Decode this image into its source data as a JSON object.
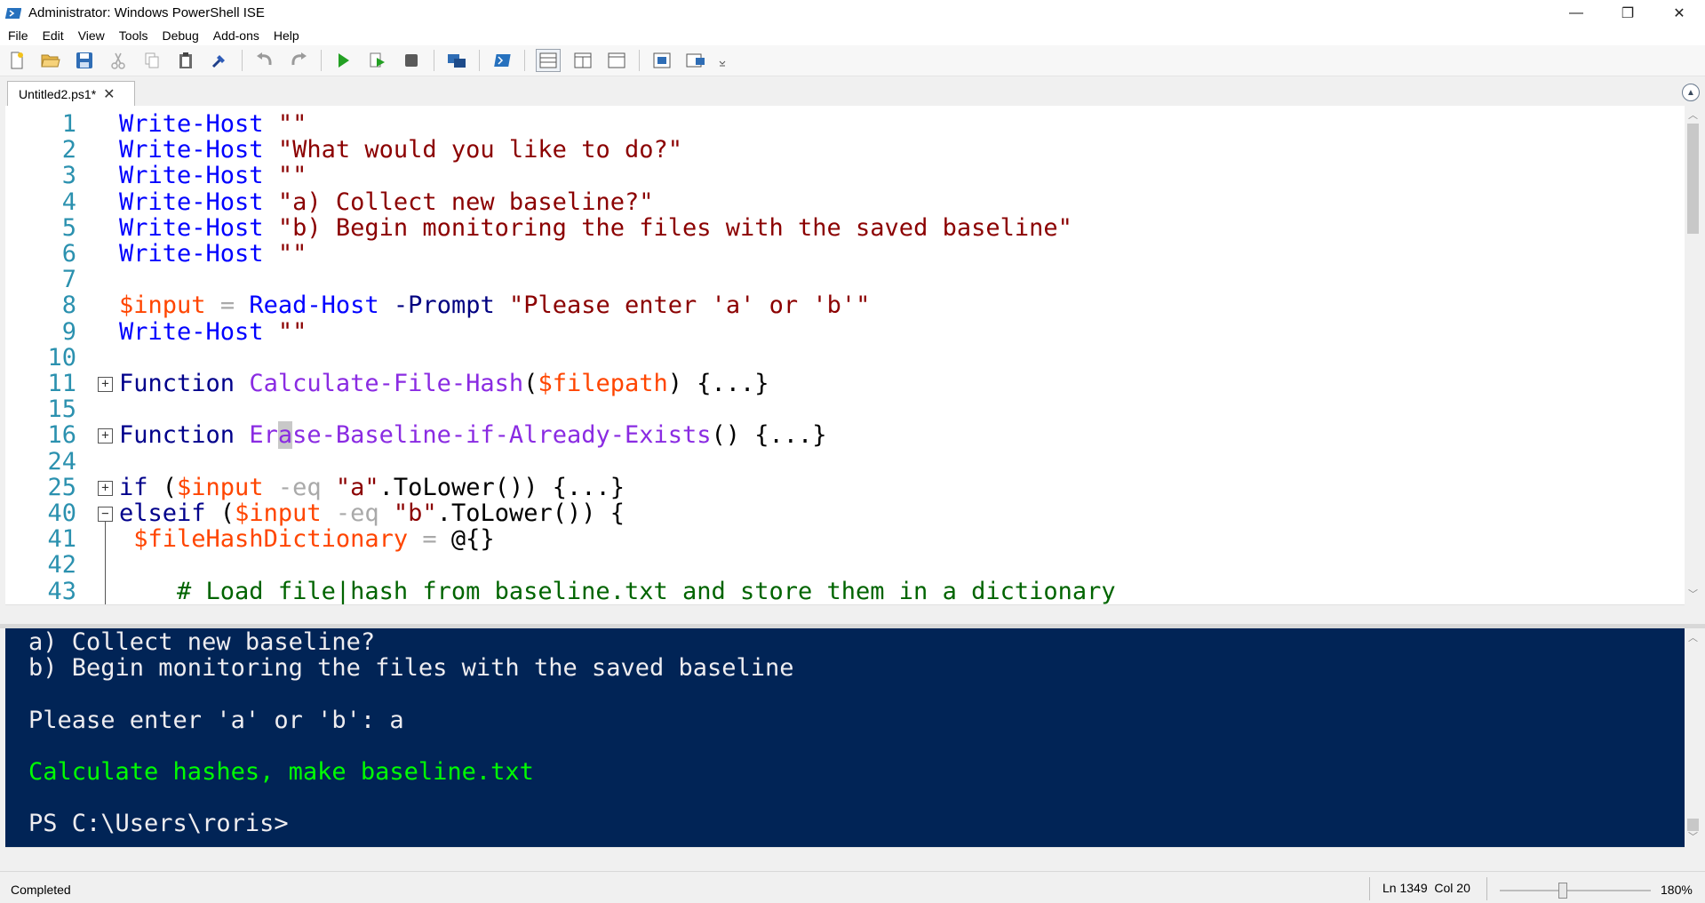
{
  "window": {
    "title": "Administrator: Windows PowerShell ISE",
    "controls": {
      "minimize": "—",
      "maximize": "❐",
      "close": "✕"
    }
  },
  "menu": [
    "File",
    "Edit",
    "View",
    "Tools",
    "Debug",
    "Add-ons",
    "Help"
  ],
  "toolbar_icons": [
    "new-script-icon",
    "open-icon",
    "save-icon",
    "cut-icon",
    "copy-icon",
    "paste-icon",
    "clear-console-icon",
    "undo-icon",
    "redo-icon",
    "run-script-icon",
    "run-selection-icon",
    "stop-icon",
    "new-remote-tab-icon",
    "start-powershell-icon",
    "script-pane-top-icon",
    "script-pane-right-icon",
    "script-pane-max-icon",
    "show-script-pane-icon",
    "show-command-addon-icon",
    "toolbar-overflow-icon"
  ],
  "tab": {
    "label": "Untitled2.ps1*",
    "close": "✕"
  },
  "editor": {
    "lines": [
      {
        "n": "1",
        "tokens": [
          [
            "c-cmd",
            "Write-Host"
          ],
          [
            "c-txt",
            " "
          ],
          [
            "c-str",
            "\"\""
          ]
        ]
      },
      {
        "n": "2",
        "tokens": [
          [
            "c-cmd",
            "Write-Host"
          ],
          [
            "c-txt",
            " "
          ],
          [
            "c-str",
            "\"What would you like to do?\""
          ]
        ]
      },
      {
        "n": "3",
        "tokens": [
          [
            "c-cmd",
            "Write-Host"
          ],
          [
            "c-txt",
            " "
          ],
          [
            "c-str",
            "\"\""
          ]
        ]
      },
      {
        "n": "4",
        "tokens": [
          [
            "c-cmd",
            "Write-Host"
          ],
          [
            "c-txt",
            " "
          ],
          [
            "c-str",
            "\"a) Collect new baseline?\""
          ]
        ]
      },
      {
        "n": "5",
        "tokens": [
          [
            "c-cmd",
            "Write-Host"
          ],
          [
            "c-txt",
            " "
          ],
          [
            "c-str",
            "\"b) Begin monitoring the files with the saved baseline\""
          ]
        ]
      },
      {
        "n": "6",
        "tokens": [
          [
            "c-cmd",
            "Write-Host"
          ],
          [
            "c-txt",
            " "
          ],
          [
            "c-str",
            "\"\""
          ]
        ]
      },
      {
        "n": "7",
        "tokens": []
      },
      {
        "n": "8",
        "tokens": [
          [
            "c-var",
            "$input"
          ],
          [
            "c-txt",
            " "
          ],
          [
            "c-op",
            "="
          ],
          [
            "c-txt",
            " "
          ],
          [
            "c-cmd",
            "Read-Host"
          ],
          [
            "c-txt",
            " "
          ],
          [
            "c-param",
            "-Prompt"
          ],
          [
            "c-txt",
            " "
          ],
          [
            "c-str",
            "\"Please enter 'a' or 'b'\""
          ]
        ]
      },
      {
        "n": "9",
        "tokens": [
          [
            "c-cmd",
            "Write-Host"
          ],
          [
            "c-txt",
            " "
          ],
          [
            "c-str",
            "\"\""
          ]
        ]
      },
      {
        "n": "10",
        "tokens": []
      },
      {
        "n": "11",
        "fold": "+",
        "tokens": [
          [
            "c-kw",
            "Function"
          ],
          [
            "c-txt",
            " "
          ],
          [
            "c-fn",
            "Calculate-File-Hash"
          ],
          [
            "c-txt",
            "("
          ],
          [
            "c-var",
            "$filepath"
          ],
          [
            "c-txt",
            ") {...}"
          ]
        ]
      },
      {
        "n": "15",
        "tokens": []
      },
      {
        "n": "16",
        "fold": "+",
        "tokens": [
          [
            "c-kw",
            "Function"
          ],
          [
            "c-txt",
            " "
          ],
          [
            "c-fn",
            "Er"
          ],
          [
            "c-fn caret-hl",
            "a"
          ],
          [
            "c-fn",
            "se-Baseline-if-Already-Exists"
          ],
          [
            "c-txt",
            "() {...}"
          ]
        ]
      },
      {
        "n": "24",
        "tokens": []
      },
      {
        "n": "25",
        "fold": "+",
        "tokens": [
          [
            "c-kw",
            "if"
          ],
          [
            "c-txt",
            " ("
          ],
          [
            "c-var",
            "$input"
          ],
          [
            "c-txt",
            " "
          ],
          [
            "c-op",
            "-eq"
          ],
          [
            "c-txt",
            " "
          ],
          [
            "c-str",
            "\"a\""
          ],
          [
            "c-txt",
            ".ToLower()) {...}"
          ]
        ]
      },
      {
        "n": "40",
        "fold": "-",
        "tokens": [
          [
            "c-kw",
            "elseif"
          ],
          [
            "c-txt",
            " ("
          ],
          [
            "c-var",
            "$input"
          ],
          [
            "c-txt",
            " "
          ],
          [
            "c-op",
            "-eq"
          ],
          [
            "c-txt",
            " "
          ],
          [
            "c-str",
            "\"b\""
          ],
          [
            "c-txt",
            ".ToLower()) {"
          ]
        ]
      },
      {
        "n": "41",
        "tokens": [
          [
            "c-txt",
            " "
          ],
          [
            "c-var",
            "$fileHashDictionary"
          ],
          [
            "c-txt",
            " "
          ],
          [
            "c-op",
            "="
          ],
          [
            "c-txt",
            " @{}"
          ]
        ]
      },
      {
        "n": "42",
        "tokens": []
      },
      {
        "n": "43",
        "tokens": [
          [
            "c-txt",
            "    "
          ],
          [
            "c-cmt",
            "# Load file|hash from baseline.txt and store them in a dictionary"
          ]
        ]
      }
    ]
  },
  "console": {
    "lines": [
      {
        "text": "a) Collect new baseline?",
        "style": "normal"
      },
      {
        "text": "b) Begin monitoring the files with the saved baseline",
        "style": "normal"
      },
      {
        "text": "",
        "style": "normal"
      },
      {
        "text": "Please enter 'a' or 'b': a",
        "style": "normal"
      },
      {
        "text": "",
        "style": "normal"
      },
      {
        "text": "Calculate hashes, make baseline.txt",
        "style": "green"
      },
      {
        "text": "",
        "style": "normal"
      },
      {
        "text": "PS C:\\Users\\roris>",
        "style": "normal"
      }
    ]
  },
  "status": {
    "text": "Completed",
    "ln": "Ln 1349",
    "col": "Col 20",
    "zoom": "180%"
  },
  "colors": {
    "console_bg": "#012456",
    "console_text": "#eeedf0",
    "console_green": "#00ff00",
    "line_numbers": "#2b91af",
    "cmdlet": "#0000ff",
    "string": "#8b0000",
    "variable": "#ff4500",
    "function": "#8a2be2",
    "keyword": "#00008b",
    "comment": "#006400"
  }
}
